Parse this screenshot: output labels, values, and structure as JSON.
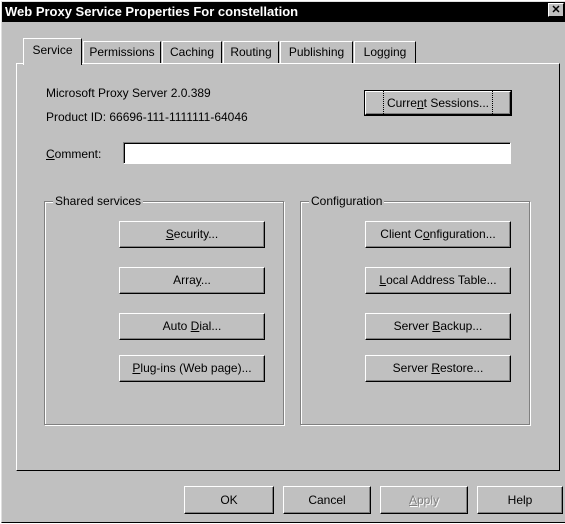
{
  "window": {
    "title": "Web Proxy Service Properties For constellation",
    "close_glyph": "✕"
  },
  "tabs": [
    {
      "label": "Service",
      "active": true
    },
    {
      "label": "Permissions",
      "active": false
    },
    {
      "label": "Caching",
      "active": false
    },
    {
      "label": "Routing",
      "active": false
    },
    {
      "label": "Publishing",
      "active": false
    },
    {
      "label": "Logging",
      "active": false
    }
  ],
  "info": {
    "product_name": "Microsoft Proxy Server 2.0.389",
    "product_id": "Product ID: 66696-111-1111111-64046"
  },
  "current_sessions_button": {
    "pre": "Curre",
    "key": "n",
    "post": "t Sessions..."
  },
  "comment": {
    "key": "C",
    "rest": "omment:",
    "value": ""
  },
  "shared_services": {
    "title": "Shared services",
    "buttons": [
      {
        "pre": "",
        "key": "S",
        "post": "ecurity..."
      },
      {
        "pre": "Arra",
        "key": "y",
        "post": "..."
      },
      {
        "pre": "Auto ",
        "key": "D",
        "post": "ial..."
      },
      {
        "pre": "",
        "key": "P",
        "post": "lug-ins (Web page)..."
      }
    ]
  },
  "configuration": {
    "title": "Configuration",
    "buttons": [
      {
        "pre": "Client C",
        "key": "o",
        "post": "nfiguration..."
      },
      {
        "pre": "",
        "key": "L",
        "post": "ocal Address Table..."
      },
      {
        "pre": "Server ",
        "key": "B",
        "post": "ackup..."
      },
      {
        "pre": "Server ",
        "key": "R",
        "post": "estore..."
      }
    ]
  },
  "footer": {
    "ok": "OK",
    "cancel": "Cancel",
    "apply_key": "A",
    "apply_rest": "pply",
    "help": "Help",
    "apply_disabled": true
  }
}
